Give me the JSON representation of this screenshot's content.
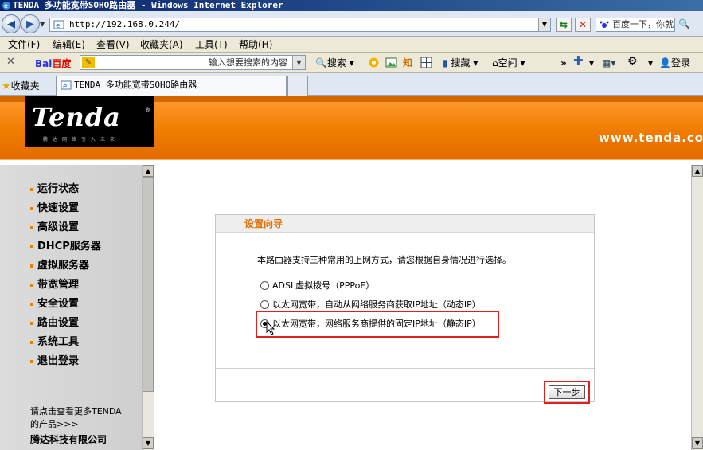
{
  "window": {
    "title": "TENDA 多功能宽带SOHO路由器 - Windows Internet Explorer"
  },
  "address_bar": {
    "url": "http://192.168.0.244/",
    "search_placeholder": "百度一下，你就"
  },
  "menu": [
    "文件(F)",
    "编辑(E)",
    "查看(V)",
    "收藏夹(A)",
    "工具(T)",
    "帮助(H)"
  ],
  "baidu_toolbar": {
    "logo_left": "Bai",
    "logo_right": "百度",
    "input_placeholder": "输入想要搜索的内容",
    "search_label": "搜索",
    "zhi_label": "知",
    "news_label": "搜藏",
    "space_label": "空间",
    "login_label": "登录"
  },
  "tabs": {
    "favorites_label": "收藏夹",
    "active_tab": "TENDA 多功能宽带SOHO路由器"
  },
  "header": {
    "brand": "Tenda",
    "tagline": "腾达网络引入未来",
    "website": "www.tenda.com"
  },
  "sidebar": {
    "items": [
      "运行状态",
      "快速设置",
      "高级设置",
      "DHCP服务器",
      "虚拟服务器",
      "带宽管理",
      "安全设置",
      "路由设置",
      "系统工具",
      "退出登录"
    ],
    "footer_line1": "请点击查看更多TENDA",
    "footer_line2": "的产品>>>",
    "company": "腾达科技有限公司"
  },
  "wizard": {
    "title": "设置向导",
    "intro": "本路由器支持三种常用的上网方式，请您根据自身情况进行选择。",
    "options": [
      {
        "label": "ADSL虚拟拨号（PPPoE）",
        "selected": false
      },
      {
        "label": "以太网宽带，自动从网络服务商获取IP地址（动态IP）",
        "selected": false
      },
      {
        "label": "以太网宽带，网络服务商提供的固定IP地址（静态IP）",
        "selected": true
      }
    ],
    "next_label": "下一步"
  },
  "colors": {
    "brand_orange": "#f07d00",
    "highlight_red": "#e02020",
    "sidebar_bullet": "#f07d00"
  }
}
